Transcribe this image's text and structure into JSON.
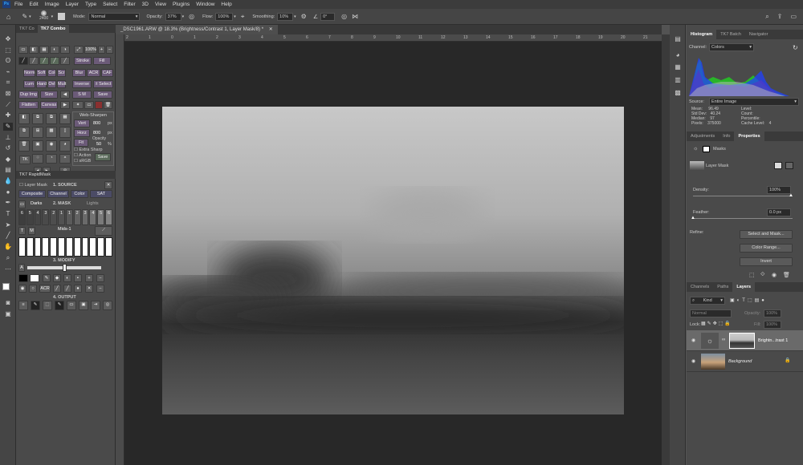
{
  "menubar": {
    "app_icon": "Ps",
    "items": [
      "File",
      "Edit",
      "Image",
      "Layer",
      "Type",
      "Select",
      "Filter",
      "3D",
      "View",
      "Plugins",
      "Window",
      "Help"
    ]
  },
  "options": {
    "brush_size": "2400",
    "mode_label": "Mode:",
    "mode_value": "Normal",
    "opacity_label": "Opacity:",
    "opacity_value": "37%",
    "flow_label": "Flow:",
    "flow_value": "100%",
    "smoothing_label": "Smoothing:",
    "smoothing_value": "10%",
    "angle_value": "0°"
  },
  "tk": {
    "tabs": [
      "TK7 Co",
      "TK7 Combo"
    ],
    "zoom": "100%",
    "stroke": "Stroke",
    "fill": "Fill",
    "row_norm": [
      "Norm",
      "Soft",
      "Col",
      "Scr"
    ],
    "row_lum": [
      "Lum",
      "Hard",
      "Ovl",
      "Mult"
    ],
    "blur": "Blur",
    "acr": "ACR",
    "caf": "CAF",
    "inverse": "Inverse",
    "select": "± Select",
    "dup": "Dup Img",
    "size": "Size",
    "flatten": "Flatten",
    "canvas": "Canvas",
    "sm": "S M",
    "save": "Save",
    "ws_title": "Web-Sharpen",
    "vert": "Vert",
    "vert_val": "800",
    "horz": "Horz",
    "horz_val": "800",
    "px": "px",
    "fit": "Fit",
    "opacity_label": "Opacity",
    "opacity_val": "50",
    "pct": "%",
    "extra": "Extra Sharp",
    "action": "Action",
    "srgb": "sRGB",
    "ws_save": "Save",
    "tk_btn": "TK",
    "rapid_title": "TK7 RapidMask",
    "layer_mask": "Layer Mask",
    "source": "1. SOURCE",
    "composite": "Composite",
    "channel": "Channel",
    "color": "Color",
    "sat": "SAT",
    "darks": "Darks",
    "mask_title": "2. MASK",
    "lights": "Lights",
    "nums": [
      "6",
      "5",
      "4",
      "3",
      "2",
      "1",
      "1",
      "2",
      "3",
      "4",
      "5",
      "6"
    ],
    "mids": "Mids-1",
    "modify": "3. MODIFY",
    "output": "4. OUTPUT"
  },
  "doc": {
    "tab_title": "_DSC1961.ARW @ 18.3% (Brightness/Contrast 1, Layer Mask/8) *",
    "ruler_marks": [
      "2",
      "1",
      "0",
      "1",
      "2",
      "3",
      "4",
      "5",
      "6",
      "7",
      "8",
      "9",
      "10",
      "11",
      "12",
      "13",
      "14",
      "15",
      "16",
      "17",
      "18",
      "19",
      "20",
      "21"
    ]
  },
  "histogram": {
    "tabs": [
      "Histogram",
      "TK7 Batch",
      "Navigator"
    ],
    "channel_label": "Channel:",
    "channel_value": "Colors",
    "source_label": "Source:",
    "source_value": "Entire Image",
    "stats_left": [
      [
        "Mean:",
        "96.49"
      ],
      [
        "Std Dev:",
        "40.24"
      ],
      [
        "Median:",
        "97"
      ],
      [
        "Pixels:",
        "375000"
      ]
    ],
    "stats_right": [
      [
        "Level:",
        ""
      ],
      [
        "Count:",
        ""
      ],
      [
        "Percentile:",
        ""
      ],
      [
        "Cache Level:",
        "4"
      ]
    ]
  },
  "properties": {
    "tabs": [
      "Adjustments",
      "Info",
      "Properties"
    ],
    "masks": "Masks",
    "layer_mask": "Layer Mask",
    "density_label": "Density:",
    "density_value": "100%",
    "feather_label": "Feather:",
    "feather_value": "0.0 px",
    "refine_label": "Refine:",
    "select_mask": "Select and Mask...",
    "color_range": "Color Range...",
    "invert": "Invert"
  },
  "layers": {
    "tabs": [
      "Channels",
      "Paths",
      "Layers"
    ],
    "kind": "Kind",
    "blend": "Normal",
    "opacity_label": "Opacity:",
    "opacity_value": "100%",
    "lock_label": "Lock:",
    "fill_label": "Fill:",
    "fill_value": "100%",
    "items": [
      {
        "name": "Brightn...trast 1"
      },
      {
        "name": "Background"
      }
    ]
  },
  "colors": {
    "accent": "#31a8ff",
    "hist_red": "#e02020",
    "hist_green": "#20d020",
    "hist_blue": "#2040ff"
  }
}
